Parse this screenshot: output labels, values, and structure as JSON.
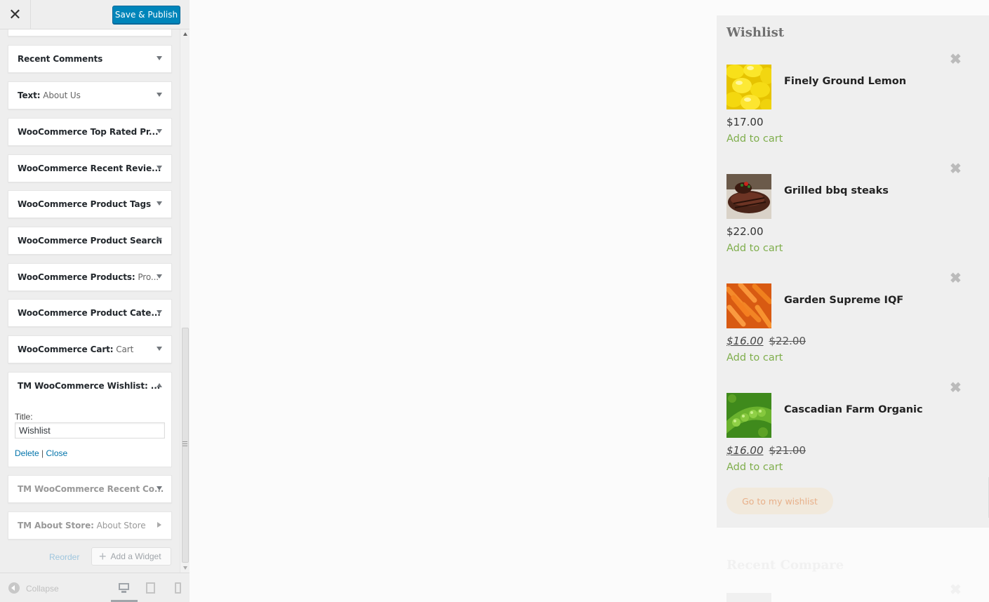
{
  "header": {
    "close_glyph": "✕",
    "save_label": "Save & Publish"
  },
  "widgets": [
    {
      "title": "Recent Comments",
      "sub": ""
    },
    {
      "title": "Text:",
      "sub": " About Us"
    },
    {
      "title": "WooCommerce Top Rated Pr...",
      "sub": ""
    },
    {
      "title": "WooCommerce Recent Revie...",
      "sub": ""
    },
    {
      "title": "WooCommerce Product Tags",
      "sub": ""
    },
    {
      "title": "WooCommerce Product Search",
      "sub": ""
    },
    {
      "title": "WooCommerce Products:",
      "sub": " Pro..."
    },
    {
      "title": "WooCommerce Product Cate...",
      "sub": ""
    },
    {
      "title": "WooCommerce Cart:",
      "sub": " Cart"
    },
    {
      "title": "TM WooCommerce Wishlist: ...",
      "sub": ""
    },
    {
      "title": "TM WooCommerce Recent Co...",
      "sub": ""
    },
    {
      "title": "TM About Store:",
      "sub": " About Store"
    }
  ],
  "wishlist_form": {
    "title_label": "Title:",
    "title_value": "Wishlist",
    "delete_label": "Delete",
    "separator": " | ",
    "close_label": "Close"
  },
  "footer_actions": {
    "reorder_label": "Reorder",
    "add_widget_label": "Add a Widget"
  },
  "sidebar_footer": {
    "collapse_label": "Collapse"
  },
  "preview": {
    "wishlist_title": "Wishlist",
    "products": [
      {
        "name": "Finely Ground Lemon",
        "price": "$17.00",
        "sale_price": "",
        "old_price": "",
        "cart_label": "Add to cart",
        "image": "lemons"
      },
      {
        "name": "Grilled bbq steaks",
        "price": "$22.00",
        "sale_price": "",
        "old_price": "",
        "cart_label": "Add to cart",
        "image": "steak"
      },
      {
        "name": "Garden Supreme IQF",
        "price": "",
        "sale_price": "$16.00",
        "old_price": "$22.00",
        "cart_label": "Add to cart",
        "image": "carrots"
      },
      {
        "name": "Cascadian Farm Organic",
        "price": "",
        "sale_price": "$16.00",
        "old_price": "$21.00",
        "cart_label": "Add to cart",
        "image": "peas"
      }
    ],
    "remove_glyph": "✖",
    "go_to_wishlist_label": "Go to my wishlist",
    "recent_compare_title": "Recent Compare"
  },
  "colors": {
    "accent": "#0085ba",
    "link": "#0073aa",
    "add_to_cart": "#7fae4c",
    "wishlist_button_bg": "#f1e9dc",
    "wishlist_button_text": "#e8b08a"
  }
}
